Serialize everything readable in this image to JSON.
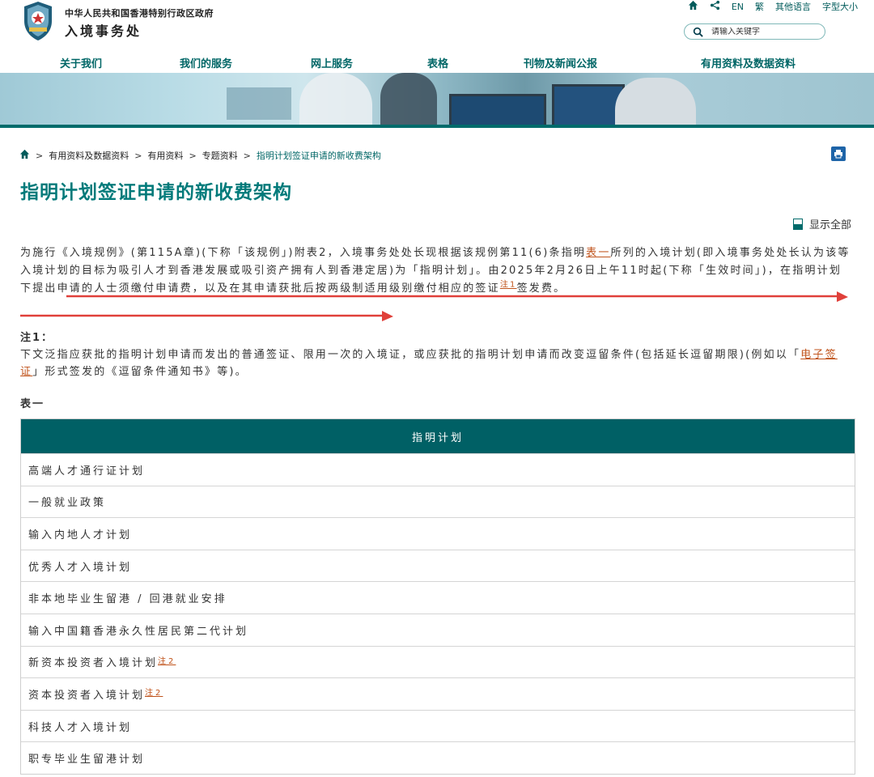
{
  "header": {
    "dept_subtitle": "中华人民共和国香港特别行政区政府",
    "dept_name": "入境事务处",
    "utils": {
      "lang_en": "EN",
      "lang_tc": "繁",
      "other_lang": "其他语言",
      "font_size": "字型大小"
    },
    "search": {
      "placeholder": "请输入关键字"
    }
  },
  "nav": [
    "关于我们",
    "我们的服务",
    "网上服务",
    "表格",
    "刊物及新闻公报",
    "有用资料及数据资料"
  ],
  "breadcrumb": [
    "有用资料及数据资料",
    "有用资料",
    "专题资料",
    "指明计划签证申请的新收费架构"
  ],
  "page_title": "指明计划签证申请的新收费架构",
  "show_all": "显示全部",
  "paragraph": {
    "p1": "为施行《入境规例》(第115A章)(下称「该规例」)附表2，入境事务处处长现根据该规例第11(6)条指明",
    "link_table": "表一",
    "p2": "所列的入境计划(即入境事务处处长认为该等入境计划的目标为吸引人才到香港发展或吸引资产拥有人到香港定居)为「指明计划」。由2025年2月26日上午11时起(下称「生效时间」)，在指明计划下提出申请的人士须缴付申请费，以及在其申请获批后按两级制适用级别缴付相应的签证",
    "link_note": "注1",
    "p3": "签发费。"
  },
  "note": {
    "heading": "注1：",
    "t1": "下文泛指应获批的指明计划申请而发出的普通签证、限用一次的入境证，或应获批的指明计划申请而改变逗留条件(包括延长逗留期限)(例如以「",
    "link": "电子签证",
    "t2": "」形式签发的《逗留条件通知书》等)。"
  },
  "table": {
    "label": "表一",
    "header": "指明计划",
    "rows": [
      {
        "name": "高端人才通行证计划",
        "note": ""
      },
      {
        "name": "一般就业政策",
        "note": ""
      },
      {
        "name": "输入内地人才计划",
        "note": ""
      },
      {
        "name": "优秀人才入境计划",
        "note": ""
      },
      {
        "name": "非本地毕业生留港 / 回港就业安排",
        "note": ""
      },
      {
        "name": "输入中国籍香港永久性居民第二代计划",
        "note": ""
      },
      {
        "name": "新资本投资者入境计划",
        "note": "注2"
      },
      {
        "name": "资本投资者入境计划",
        "note": "注2"
      },
      {
        "name": "科技人才入境计划",
        "note": ""
      },
      {
        "name": "职专毕业生留港计划",
        "note": ""
      }
    ]
  },
  "colors": {
    "accent": "#006666",
    "table_header": "#006065",
    "link": "#c0531b",
    "annotation": "#e0403a"
  }
}
